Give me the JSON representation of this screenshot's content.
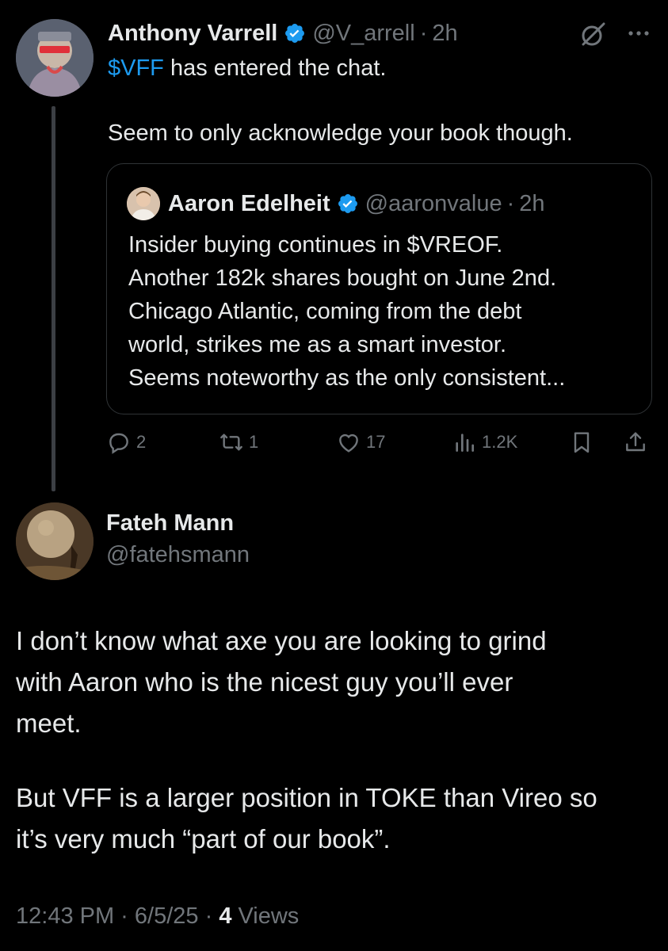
{
  "parent": {
    "display_name": "Anthony Varrell",
    "handle": "@V_arrell",
    "separator": "·",
    "time": "2h",
    "text_cashtag": "$VFF",
    "text_line1_rest": " has entered the chat.",
    "text_line2": "Seem to only acknowledge your book though."
  },
  "quote": {
    "display_name": "Aaron Edelheit",
    "handle": "@aaronvalue",
    "separator": "·",
    "time": "2h",
    "lines": [
      "Insider buying continues in $VREOF.",
      "Another 182k shares bought on June 2nd.",
      "Chicago Atlantic, coming from the debt",
      "world, strikes me as a smart investor.",
      "Seems noteworthy as the only consistent..."
    ]
  },
  "actions": {
    "replies": "2",
    "reposts": "1",
    "likes": "17",
    "views": "1.2K"
  },
  "reply": {
    "display_name": "Fateh Mann",
    "handle": "@fatehsmann",
    "lines": [
      "I don’t know what axe you are looking to grind",
      "with Aaron who is the nicest guy you’ll ever",
      "meet.",
      "But VFF is a larger position in TOKE than Vireo so",
      "it’s very much “part of our book”."
    ],
    "footer_time": "12:43 PM · 6/5/25 · ",
    "footer_views_count": "4",
    "footer_views_label": "Views"
  },
  "icons": {
    "verified": "verified-badge-icon",
    "grok": "grok-icon",
    "more": "more-icon",
    "reply": "reply-icon",
    "repost": "repost-icon",
    "like": "like-icon",
    "views": "views-icon",
    "bookmark": "bookmark-icon",
    "share": "share-icon"
  },
  "colors": {
    "background": "#000000",
    "text": "#e7e9ea",
    "muted": "#71767b",
    "accent": "#1d9bf0",
    "border": "#2f3336"
  }
}
